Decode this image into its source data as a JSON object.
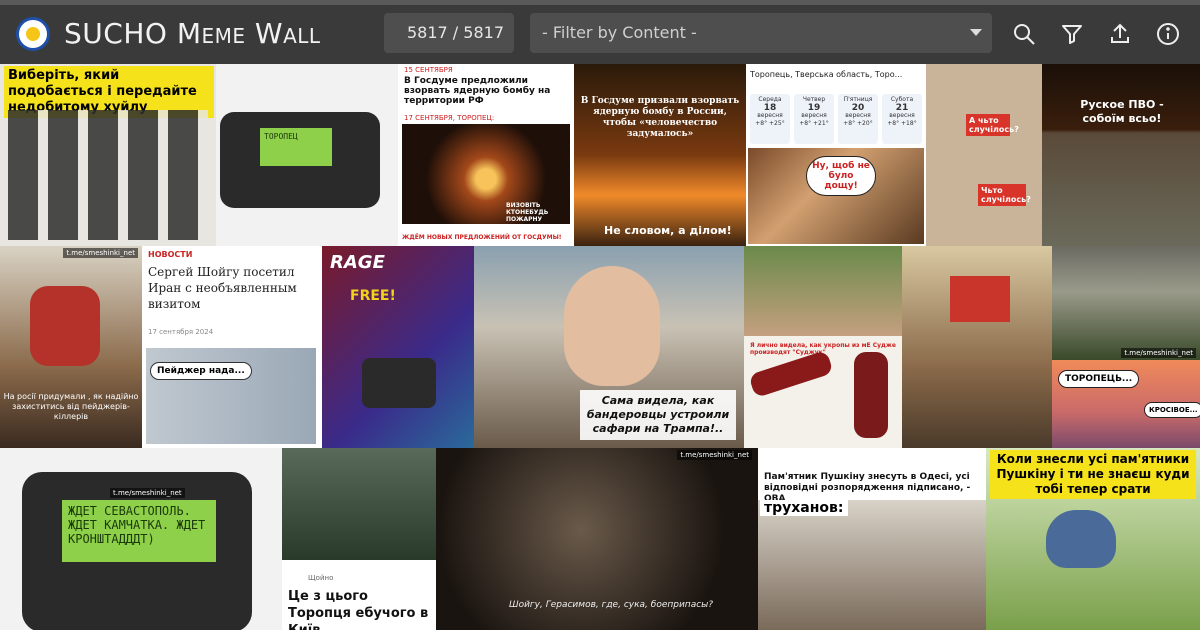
{
  "app": {
    "title": "SUCHO Meme Wall",
    "counter": "5817 / 5817",
    "filter_placeholder": "- Filter by Content -"
  },
  "toolbar": {
    "icons": [
      "search-icon",
      "filter-icon",
      "upload-icon",
      "info-icon"
    ]
  },
  "colors": {
    "topbar": "#3a3a3a",
    "control_bg": "#4e4e4e",
    "text": "#f2f2f2"
  },
  "tiles": {
    "t1_caption": "Виберіть, який подобається і передайте недобитому хуйлу",
    "t2_screen": "ТОРОПЕЦ",
    "t3_date1": "15 СЕНТЯБРЯ",
    "t3_head1": "В Госдуме предложили взорвать ядерную бомбу на территории РФ",
    "t3_date2": "17 СЕНТЯБРЯ, ТОРОПЕЦ:",
    "t3_sign": "ВИЗОВІТЬ КТОНЕБУДЬ ПОЖАРНУ",
    "t3_footer": "ЖДЁМ НОВЫХ ПРЕДЛОЖЕНИЙ ОТ ГОСДУМЫ!",
    "t4_head": "В Госдуме призвали взорвать ядерную бомбу в России, чтобы «человечество задумалось»",
    "t4_bottom": "Не словом, а ділом!",
    "t5_search": "Торопець, Тверська область, Торо...",
    "t5_days": [
      {
        "day": "Середа",
        "date": "18",
        "month": "вересня",
        "temp": "+8° +25°"
      },
      {
        "day": "Четвер",
        "date": "19",
        "month": "вересня",
        "temp": "+8° +21°"
      },
      {
        "day": "П'ятниця",
        "date": "20",
        "month": "вересня",
        "temp": "+8° +20°"
      },
      {
        "day": "Субота",
        "date": "21",
        "month": "вересня",
        "temp": "+8° +18°"
      }
    ],
    "t5_bubble": "Ну, щоб не було дощу!",
    "t6_bubble1": "А чьто случілось?",
    "t6_bubble2": "Чьто случілось?",
    "t7_caption": "Руское ПВО - собоїм всьо!",
    "t8_caption": "На росії придумали , як надійно захиститись від пейджерів-кіллерів",
    "t9_tag": "НОВОСТИ",
    "t9_head": "Сергей Шойгу посетил Иран с необъявленным визитом",
    "t9_date": "17 сентября 2024",
    "t9_sticker": "Пейджер нада...",
    "t10_logo": "RAGE",
    "t10_free": "FREE!",
    "t11_caption": "Сама видела, как бандеровцы устроили сафари на Трампа!..",
    "t12_caption": "Я лично видела, как укропы из мЕ Судже производят \"Суджук\"",
    "t14_bubble1": "ТОРОПЕЦЬ...",
    "t14_bubble2": "КРОСІВОЕ...",
    "t15_screen": "ЖДЕТ СЕВАСТОПОЛЬ. ЖДЕТ КАМЧАТКА. ЖДЕТ КРОНШТАДДДТ)",
    "t16_meta": "Щойно",
    "t16_caption": "Це з цього Торопця ебучого в Київ",
    "t17_sub": "Шойгу, Герасимов, где, сука, боеприпасы?",
    "t18_head": "Пам'ятник Пушкіну знесуть в Одесі, усі відповідні розпорядження підписано, - ОВА",
    "t18_caption": "труханов:",
    "t19_caption": "Коли знесли усі пам'ятники Пушкіну і ти не знаєш куди тобі тепер срати",
    "watermark": "t.me/smeshinki_net"
  }
}
